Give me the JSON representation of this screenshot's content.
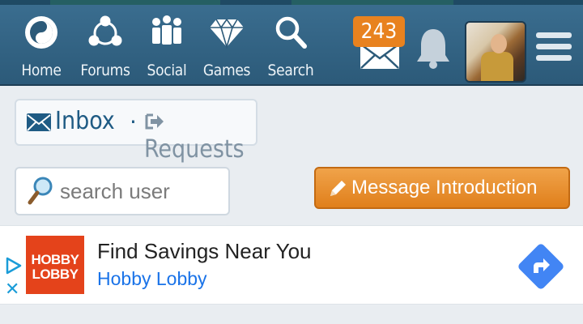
{
  "nav": {
    "items": [
      {
        "label": "Home",
        "icon": "yin-yang-icon"
      },
      {
        "label": "Forums",
        "icon": "forums-icon"
      },
      {
        "label": "Social",
        "icon": "people-icon"
      },
      {
        "label": "Games",
        "icon": "diamond-icon"
      },
      {
        "label": "Search",
        "icon": "search-icon"
      }
    ],
    "mail_count": "243",
    "colors": {
      "nav_bg": "#3a6d8f",
      "badge": "#e8821f"
    }
  },
  "tabs": {
    "inbox": "Inbox",
    "separator": "·",
    "requests": "Requests"
  },
  "search": {
    "placeholder": "search user"
  },
  "message_button": {
    "label": "Message Introduction"
  },
  "ad": {
    "logo_line1": "HOBBY",
    "logo_line2": "LOBBY",
    "title": "Find Savings Near You",
    "advertiser": "Hobby Lobby",
    "colors": {
      "logo_bg": "#e4431b",
      "link": "#1a73e8",
      "cta": "#4285f4"
    }
  }
}
